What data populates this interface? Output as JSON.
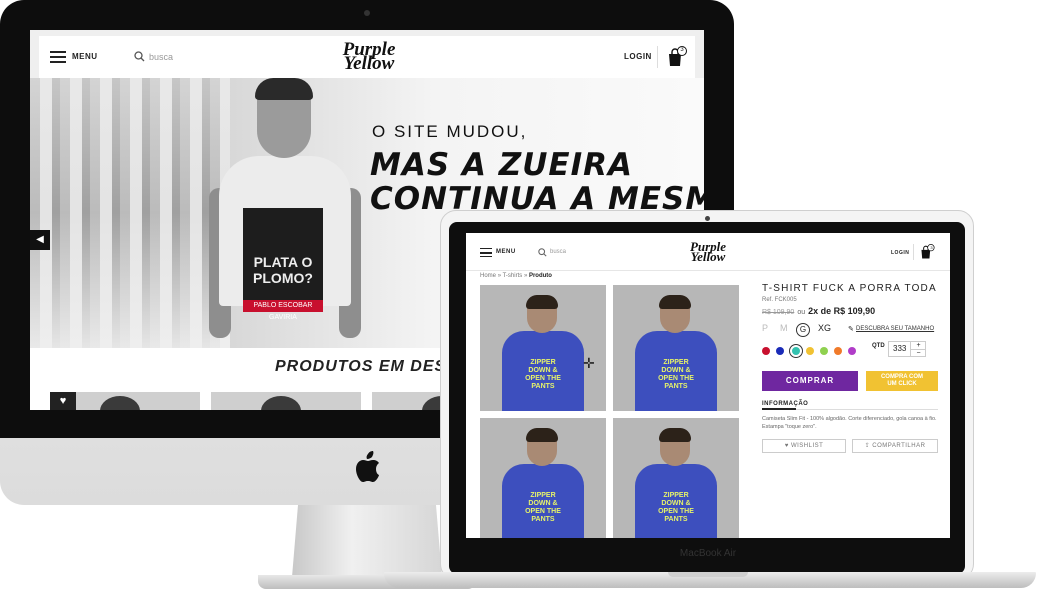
{
  "desktop": {
    "menu_label": "MENU",
    "search_placeholder": "busca",
    "logo_top": "Purple",
    "logo_bottom": "Yellow",
    "login_label": "LOGIN",
    "cart_count": "3",
    "hero": {
      "line1": "O SITE MUDOU,",
      "line2": "MAS A ZUEIRA",
      "line3": "CONTINUA A MESMA",
      "shirt_print_line1": "PLATA O",
      "shirt_print_line2": "PLOMO?",
      "shirt_print_band": "PABLO ESCOBAR GAVIRIA"
    },
    "section_title": "PRODUTOS EM DESTAQUE"
  },
  "laptop": {
    "device_label": "MacBook Air",
    "menu_label": "MENU",
    "search_placeholder": "busca",
    "logo_top": "Purple",
    "logo_bottom": "Yellow",
    "login_label": "LOGIN",
    "cart_count": "3",
    "breadcrumb": {
      "home": "Home",
      "sep": "»",
      "category": "T-shirts",
      "current": "Produto"
    },
    "product": {
      "title": "T-SHIRT FUCK A PORRA TODA",
      "ref": "Ref. FCK005",
      "old_price": "R$ 109,90",
      "ou": "ou",
      "installments": "2x de R$ 109,90",
      "sizes": [
        "P",
        "M",
        "G",
        "XG"
      ],
      "selected_size": "G",
      "size_guide": "DESCUBRA SEU TAMANHO",
      "colors": [
        "#c8102e",
        "#1a2bb8",
        "#34c2b0",
        "#f1c232",
        "#8fd14f",
        "#f07a2a",
        "#b03cc8"
      ],
      "selected_color": "#34c2b0",
      "qtd_label": "QTD",
      "qtd_value": "333",
      "plus": "+",
      "minus": "−",
      "buy_label": "COMPRAR",
      "one_click_label": "COMPRA COM\nUM CLICK",
      "info_label": "INFORMAÇÃO",
      "info_text": "Camiseta Slim Fit - 100% algodão. Corte diferenciado, gola canoa à fio. Estampa \"toque zero\".",
      "wishlist_label": "WISHLIST",
      "share_label": "COMPARTILHAR",
      "shirt_print": "ZIPPER\nDOWN &\nOPEN THE\nPANTS"
    }
  }
}
